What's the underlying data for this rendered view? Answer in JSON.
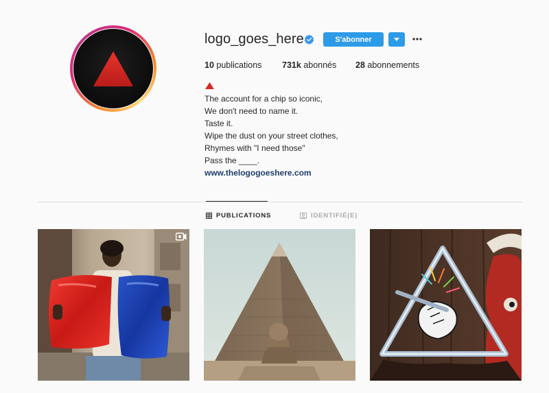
{
  "profile": {
    "username": "logo_goes_here",
    "verified": true,
    "follow_label": "S'abonner",
    "stats": {
      "posts_count": "10",
      "posts_label": "publications",
      "followers_count": "731k",
      "followers_label": "abonnés",
      "following_count": "28",
      "following_label": "abonnements"
    },
    "bio": {
      "lines": [
        "The account for a chip so iconic,",
        "We don't need to name it.",
        "Taste it.",
        "Wipe the dust on your street clothes,",
        "Rhymes with \"I need those\"",
        "Pass the ____."
      ],
      "link": "www.thelogogoeshere.com"
    }
  },
  "tabs": [
    {
      "label": "PUBLICATIONS",
      "icon": "grid-icon",
      "active": true
    },
    {
      "label": "IDENTIFIÉ(E)",
      "icon": "tagged-icon",
      "active": false
    }
  ],
  "posts": [
    {
      "kind": "reel",
      "icon": "reel-icon",
      "description": "person holding red and blue chip bags"
    },
    {
      "kind": "image",
      "description": "pyramid with sphinx"
    },
    {
      "kind": "image",
      "description": "cartoon hand holding a triangle"
    }
  ],
  "colors": {
    "accent": "#2e9be8",
    "link": "#1e3d6b",
    "text": "#262626",
    "muted": "#a8a8a8",
    "brand_red": "#d42a26"
  }
}
